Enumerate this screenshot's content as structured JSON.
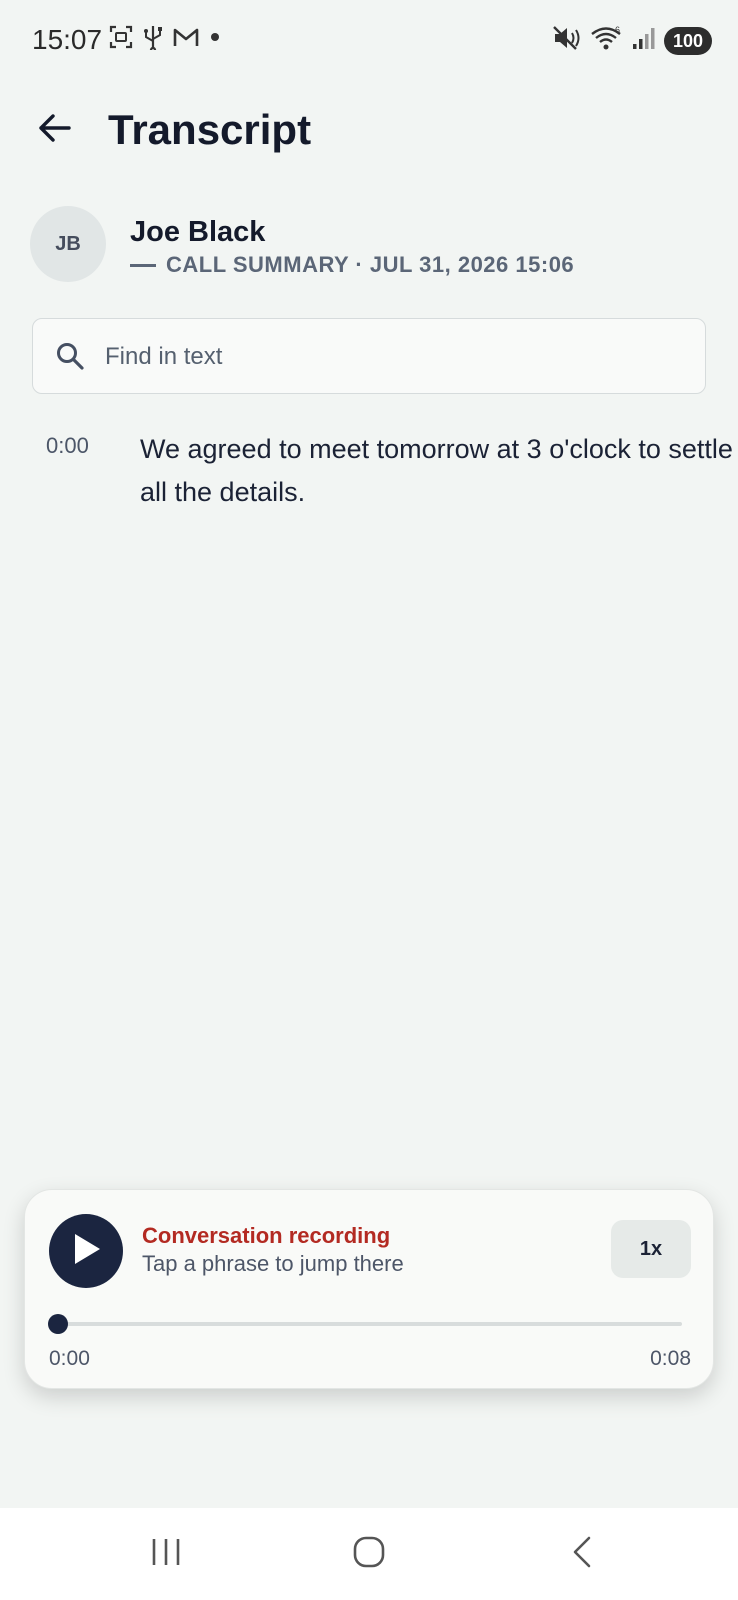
{
  "status_bar": {
    "time": "15:07",
    "battery": "100",
    "left_icons": [
      "screenshot-icon",
      "usb-icon",
      "gmail-icon",
      "dot-icon"
    ],
    "right_icons": [
      "mute-icon",
      "wifi-icon",
      "signal-icon"
    ]
  },
  "app_bar": {
    "title": "Transcript",
    "back_icon": "arrow-left-icon"
  },
  "contact": {
    "initials": "JB",
    "name": "Joe Black",
    "meta": "CALL SUMMARY · JUL 31, 2026 15:06"
  },
  "search": {
    "placeholder": "Find in text",
    "value": "",
    "icon": "search-icon"
  },
  "transcript": [
    {
      "time": "0:00",
      "text": "We agreed to meet tomorrow at 3 o'clock to settle all the details."
    }
  ],
  "player": {
    "title": "Conversation recording",
    "subtitle": "Tap a phrase to jump there",
    "speed": "1x",
    "current_time": "0:00",
    "total_time": "0:08",
    "progress": 0,
    "play_icon": "play-icon",
    "accent_color": "#b32a22",
    "primary_color": "#1b2540"
  },
  "nav_bar": {
    "buttons": [
      "recent-apps-icon",
      "home-icon",
      "back-icon"
    ]
  }
}
